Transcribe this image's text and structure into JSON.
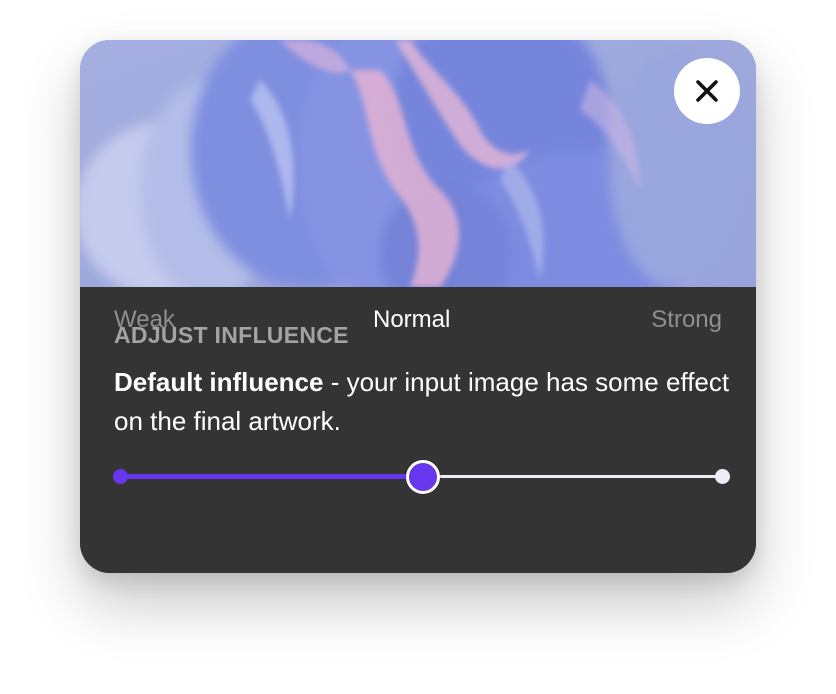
{
  "card": {
    "image_alt": "Blurred abstract painting in periwinkle blue and pink tones",
    "close_icon": "close-icon"
  },
  "influence": {
    "eyebrow": "ADJUST INFLUENCE",
    "description_bold": "Default influence",
    "description_rest": " - your input image has some effect on the final artwork.",
    "slider": {
      "labels": [
        "Weak",
        "Normal",
        "Strong"
      ],
      "selected_label": "Normal",
      "value_fraction": 0.5
    }
  },
  "colors": {
    "accent": "#6737ee",
    "panel_bg": "#343434",
    "muted_text": "#8f8f8f",
    "eyebrow_text": "#a3a3a3",
    "track_rest": "#eeecf6"
  }
}
